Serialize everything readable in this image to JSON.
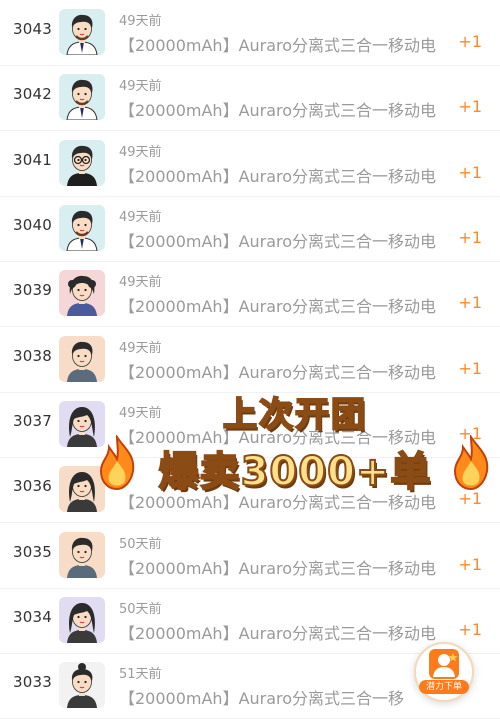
{
  "orders": [
    {
      "number": "3043",
      "time": "49天前",
      "product": "【20000mAh】Auraro分离式三合一移动电",
      "qty": "+1",
      "avatar": {
        "bg": "#d8eef0",
        "style": "male-suit"
      }
    },
    {
      "number": "3042",
      "time": "49天前",
      "product": "【20000mAh】Auraro分离式三合一移动电",
      "qty": "+1",
      "avatar": {
        "bg": "#d8eef0",
        "style": "male-suit"
      }
    },
    {
      "number": "3041",
      "time": "49天前",
      "product": "【20000mAh】Auraro分离式三合一移动电",
      "qty": "+1",
      "avatar": {
        "bg": "#d8eef0",
        "style": "male-glasses"
      }
    },
    {
      "number": "3040",
      "time": "49天前",
      "product": "【20000mAh】Auraro分离式三合一移动电",
      "qty": "+1",
      "avatar": {
        "bg": "#d8eef0",
        "style": "male-suit"
      }
    },
    {
      "number": "3039",
      "time": "49天前",
      "product": "【20000mAh】Auraro分离式三合一移动电",
      "qty": "+1",
      "avatar": {
        "bg": "#f6d7d7",
        "style": "female-curly"
      }
    },
    {
      "number": "3038",
      "time": "49天前",
      "product": "【20000mAh】Auraro分离式三合一移动电",
      "qty": "+1",
      "avatar": {
        "bg": "#f7dcc8",
        "style": "male-casual"
      }
    },
    {
      "number": "3037",
      "time": "49天前",
      "product": "【20000mAh】Auraro分离式三合一移动电",
      "qty": "+1",
      "avatar": {
        "bg": "#e2dcf2",
        "style": "female-long"
      }
    },
    {
      "number": "3036",
      "time": "",
      "product": "【20000mAh】Auraro分离式三合一移动电",
      "qty": "+1",
      "avatar": {
        "bg": "#f7dcc8",
        "style": "female-long"
      }
    },
    {
      "number": "3035",
      "time": "50天前",
      "product": "【20000mAh】Auraro分离式三合一移动电",
      "qty": "+1",
      "avatar": {
        "bg": "#f7dcc8",
        "style": "male-casual"
      }
    },
    {
      "number": "3034",
      "time": "50天前",
      "product": "【20000mAh】Auraro分离式三合一移动电",
      "qty": "+1",
      "avatar": {
        "bg": "#e2dcf2",
        "style": "female-long"
      }
    },
    {
      "number": "3033",
      "time": "51天前",
      "product": "【20000mAh】Auraro分离式三合一移",
      "qty": "",
      "avatar": {
        "bg": "#f2f2f2",
        "style": "female-bun"
      }
    }
  ],
  "banner": {
    "line1": "上次开团",
    "line2": "爆卖3000+单",
    "icons": [
      "flame-icon",
      "flame-icon"
    ]
  },
  "fab": {
    "label": "潜力下单",
    "icon": "user-star-icon"
  },
  "colors": {
    "qty": "#ff8a2a",
    "muted_text": "#9a9a9a",
    "banner_text": "#ffe08a",
    "banner_stroke": "#8b4b15",
    "fab_label_bg": "#ff7a1a"
  }
}
